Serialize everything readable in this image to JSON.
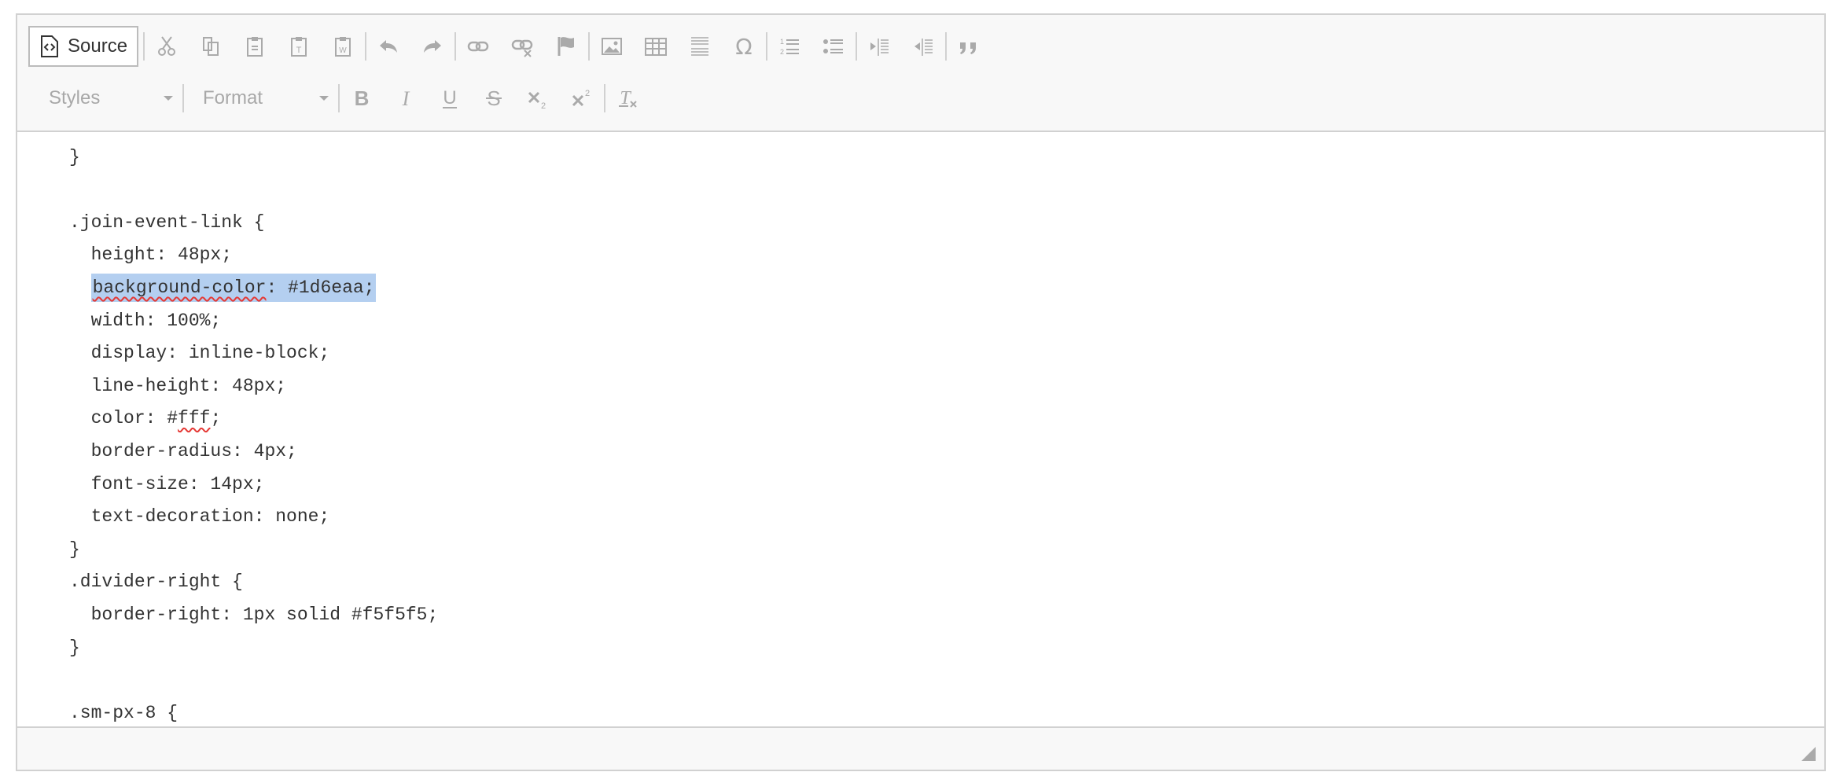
{
  "toolbar": {
    "source_label": "Source",
    "row1_icons": [
      "cut-icon",
      "copy-icon",
      "paste-icon",
      "paste-text-icon",
      "paste-word-icon",
      "undo-icon",
      "redo-icon",
      "link-icon",
      "unlink-icon",
      "anchor-icon",
      "image-icon",
      "table-icon",
      "horizontal-line-icon",
      "special-char-icon",
      "numbered-list-icon",
      "bulleted-list-icon",
      "decrease-indent-icon",
      "increase-indent-icon",
      "blockquote-icon"
    ],
    "styles_label": "Styles",
    "format_label": "Format",
    "row2_icons": [
      "bold-icon",
      "italic-icon",
      "underline-icon",
      "strike-icon",
      "subscript-icon",
      "superscript-icon",
      "remove-format-icon"
    ]
  },
  "editor": {
    "lines": [
      "  text-decoration: none;",
      "}",
      "",
      ".join-event-link {",
      "  height: 48px;",
      "  background-color: #1d6eaa;",
      "  width: 100%;",
      "  display: inline-block;",
      "  line-height: 48px;",
      "  color: #fff;",
      "  border-radius: 4px;",
      "  font-size: 14px;",
      "  text-decoration: none;",
      "}",
      ".divider-right {",
      "  border-right: 1px solid #f5f5f5;",
      "}",
      "",
      ".sm-px-8 {"
    ],
    "selected_text": "background-color: #1d6eaa;",
    "highlight_color": "#b4cff0",
    "spellcheck_color": "#e53935"
  },
  "colors": {
    "toolbar_bg": "#f8f8f8",
    "border": "#d1d1d1",
    "icon": "#aaaaaa"
  }
}
